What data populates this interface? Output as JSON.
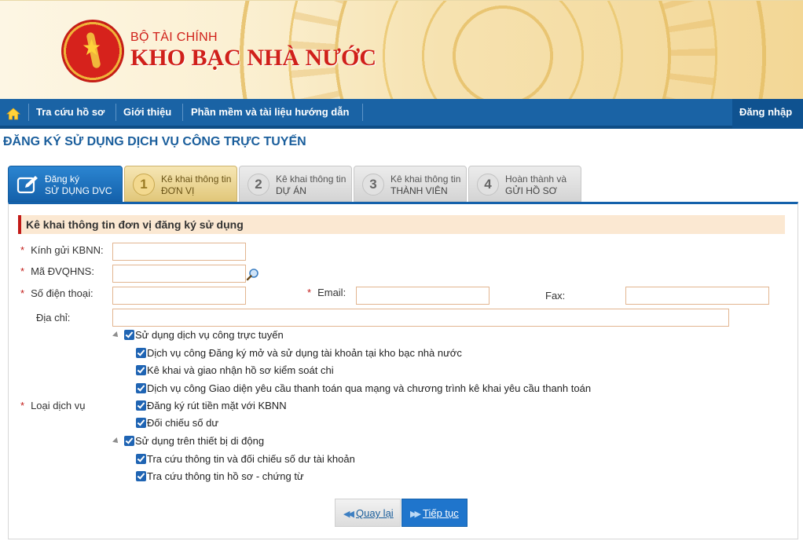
{
  "header": {
    "org_line1": "BỘ TÀI CHÍNH",
    "org_line2": "KHO BẠC NHÀ NƯỚC"
  },
  "nav": {
    "home_icon": "home-icon",
    "items": [
      "Tra cứu hồ sơ",
      "Giới thiệu",
      "Phần mềm và tài liệu hướng dẫn"
    ],
    "login": "Đăng nhập"
  },
  "page_title": "ĐĂNG KÝ SỬ DỤNG DỊCH VỤ CÔNG TRỰC TUYẾN",
  "steps": [
    {
      "num": "",
      "line1": "Đăng ký",
      "line2": "SỬ DỤNG DVC"
    },
    {
      "num": "1",
      "line1": "Kê khai thông tin",
      "line2": "ĐƠN VỊ"
    },
    {
      "num": "2",
      "line1": "Kê khai thông tin",
      "line2": "DỰ ÁN"
    },
    {
      "num": "3",
      "line1": "Kê khai thông tin",
      "line2": "THÀNH VIÊN"
    },
    {
      "num": "4",
      "line1": "Hoàn thành và",
      "line2": "GỬI HỒ SƠ"
    }
  ],
  "form": {
    "section_title": "Kê khai thông tin đơn vị đăng ký sử dụng",
    "required_mark": "*",
    "fields": {
      "kbnn_label": "Kính gửi KBNN:",
      "kbnn_value": "",
      "dvqhns_label": "Mã ĐVQHNS:",
      "dvqhns_value": "",
      "phone_label": "Số điện thoại:",
      "phone_value": "",
      "email_label": "Email:",
      "email_value": "",
      "fax_label": "Fax:",
      "fax_value": "",
      "address_label": "Địa chỉ:",
      "address_value": "",
      "service_type_label": "Loại dịch vụ"
    },
    "service_tree": {
      "group1": "Sử dụng dịch vụ công trực tuyến",
      "group1_items": [
        "Dịch vụ công Đăng ký mở và sử dụng tài khoản tại kho bạc nhà nước",
        "Kê khai và giao nhận hồ sơ kiểm soát chi",
        "Dịch vụ công Giao diện yêu cầu thanh toán qua mạng và chương trình kê khai yêu cầu thanh toán",
        "Đăng ký rút tiền mặt với KBNN",
        "Đối chiếu số dư"
      ],
      "group2": "Sử dụng trên thiết bị di động",
      "group2_items": [
        "Tra cứu thông tin và đối chiếu số dư tài khoản",
        "Tra cứu thông tin hồ sơ - chứng từ"
      ]
    }
  },
  "buttons": {
    "back": "Quay lại",
    "next": "Tiếp tục"
  },
  "colors": {
    "nav_blue": "#1a63a5",
    "title_blue": "#1a5e9c",
    "brand_red": "#d0201a",
    "section_bg": "#fbe8d2"
  }
}
